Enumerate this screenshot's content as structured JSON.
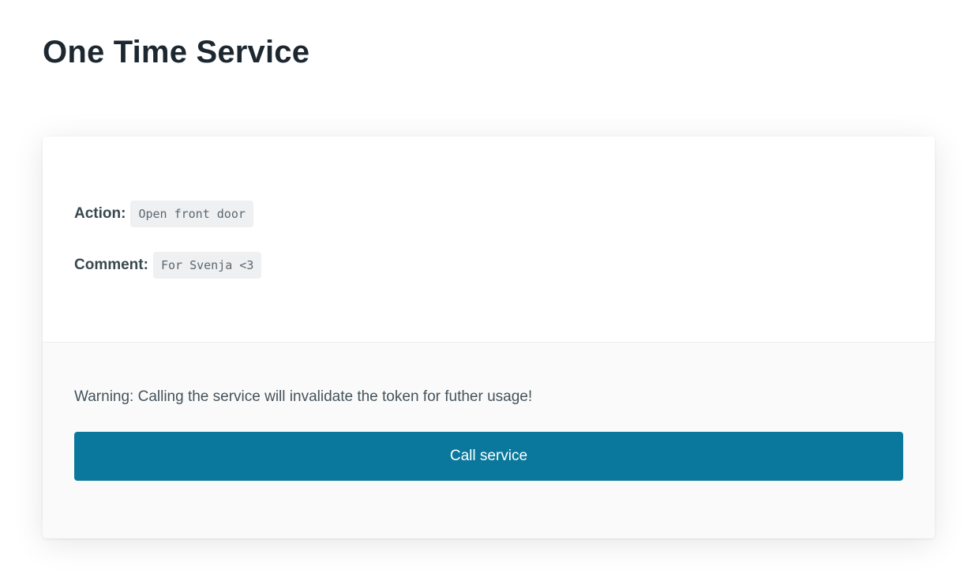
{
  "page": {
    "title": "One Time Service"
  },
  "service": {
    "action_label": "Action:",
    "action_value": "Open front door",
    "comment_label": "Comment:",
    "comment_value": "For Svenja <3"
  },
  "footer": {
    "warning": "Warning: Calling the service will invalidate the token for futher usage!",
    "button_label": "Call service"
  },
  "colors": {
    "accent": "#0a789c",
    "title": "#1d2730",
    "text": "#384850",
    "code_background": "#eef0f2",
    "footer_background": "#fafafa"
  }
}
